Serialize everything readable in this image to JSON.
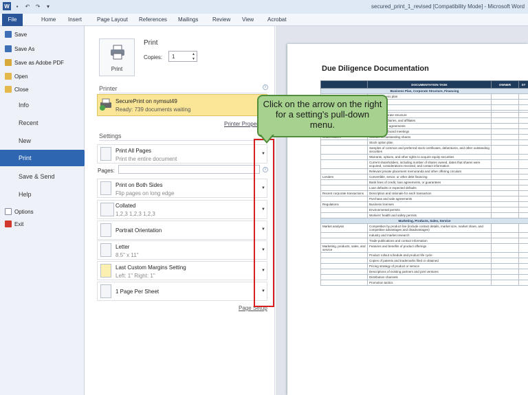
{
  "window": {
    "title": "secured_print_1_revised [Compatibility Mode] - Microsoft Word"
  },
  "ribbon": {
    "tabs": [
      "File",
      "Home",
      "Insert",
      "Page Layout",
      "References",
      "Mailings",
      "Review",
      "View",
      "Acrobat"
    ]
  },
  "backstage": {
    "commands": [
      "Save",
      "Save As",
      "Save as Adobe PDF",
      "Open",
      "Close"
    ],
    "tabs": [
      "Info",
      "Recent",
      "New",
      "Print",
      "Save & Send",
      "Help"
    ],
    "bottom_commands": [
      "Options",
      "Exit"
    ],
    "active_tab": "Print"
  },
  "print": {
    "heading": "Print",
    "button_label": "Print",
    "copies_label": "Copies:",
    "copies_value": "1"
  },
  "printer": {
    "section_title": "Printer",
    "name": "SecurePrint on nymsut49",
    "status": "Ready: 739 documents waiting",
    "properties_link": "Printer Properties"
  },
  "settings": {
    "section_title": "Settings",
    "pages_label": "Pages:",
    "items": [
      {
        "main": "Print All Pages",
        "sub": "Print the entire document"
      },
      {
        "main": "Print on Both Sides",
        "sub": "Flip pages on long edge"
      },
      {
        "main": "Collated",
        "sub": "1,2,3   1,2,3   1,2,3"
      },
      {
        "main": "Portrait Orientation",
        "sub": ""
      },
      {
        "main": "Letter",
        "sub": "8.5\" x 11\""
      },
      {
        "main": "Last Custom Margins Setting",
        "sub": "Left: 1\"   Right: 1\""
      },
      {
        "main": "1 Page Per Sheet",
        "sub": ""
      }
    ],
    "page_setup_link": "Page Setup"
  },
  "callout": {
    "text": "Click on the arrow on the right for a setting's pull-down menu."
  },
  "preview": {
    "doc_title": "Due Diligence Documentation",
    "columns": [
      "",
      "DOCUMENTATION TASK",
      "OWNER",
      "ST"
    ],
    "rows": [
      {
        "group": "Business Plan, Corporate Structure, Financing"
      },
      {
        "cat": "",
        "task": "...year business plan"
      },
      {
        "cat": "",
        "task": "...s plan"
      },
      {
        "cat": "",
        "task": "...corporation"
      },
      {
        "cat": "",
        "task": ""
      },
      {
        "cat": "",
        "task": "...ges in corporate structure"
      },
      {
        "cat": "",
        "task": "Parent, subsidiaries, and affiliates"
      },
      {
        "cat": "",
        "task": "Shareholders' agreements"
      },
      {
        "cat": "",
        "task": "Minutes from board meetings"
      },
      {
        "cat": "Shareholders",
        "task": "Number of outstanding shares"
      },
      {
        "cat": "",
        "task": "Stock option plan"
      },
      {
        "cat": "",
        "task": "Samples of common and preferred stock certificates, debentures, and other outstanding securities"
      },
      {
        "cat": "",
        "task": "Warrants, options, and other rights to acquire equity securities"
      },
      {
        "cat": "",
        "task": "Current shareholders, including number of shares owned, dates that shares were acquired, considerations received, and contact information"
      },
      {
        "cat": "",
        "task": "Relevant private placement memoranda and other offering circulars"
      },
      {
        "cat": "Lenders",
        "task": "Convertible, senior, or other debt financing"
      },
      {
        "cat": "",
        "task": "Bank lines of credit, loan agreements, or guarantees"
      },
      {
        "cat": "",
        "task": "Loan defaults or expected defaults"
      },
      {
        "cat": "Recent corporate transactions",
        "task": "Description and rationale for each transaction"
      },
      {
        "cat": "",
        "task": "Purchase and sale agreements"
      },
      {
        "cat": "Regulations",
        "task": "Business licenses"
      },
      {
        "cat": "",
        "task": "Environmental permits"
      },
      {
        "cat": "",
        "task": "Workers' health and safety permits"
      },
      {
        "group": "Marketing, Products, Sales, Service"
      },
      {
        "cat": "Market analysis",
        "task": "Competition by product line (include contact details, market size, market share, and competitive advantages and disadvantages)"
      },
      {
        "cat": "",
        "task": "Industry and market research"
      },
      {
        "cat": "",
        "task": "Trade publications and contact information"
      },
      {
        "cat": "Marketing, products, sales, and service",
        "task": "Features and benefits of product offerings"
      },
      {
        "cat": "",
        "task": "Product rollout schedule and product life cycle"
      },
      {
        "cat": "",
        "task": "Copies of patents and trademarks filed or obtained"
      },
      {
        "cat": "",
        "task": "Pricing strategy of product or service"
      },
      {
        "cat": "",
        "task": "Descriptions of existing partners and joint ventures"
      },
      {
        "cat": "",
        "task": "Distribution channels"
      },
      {
        "cat": "",
        "task": "Promotion tactics"
      }
    ]
  }
}
